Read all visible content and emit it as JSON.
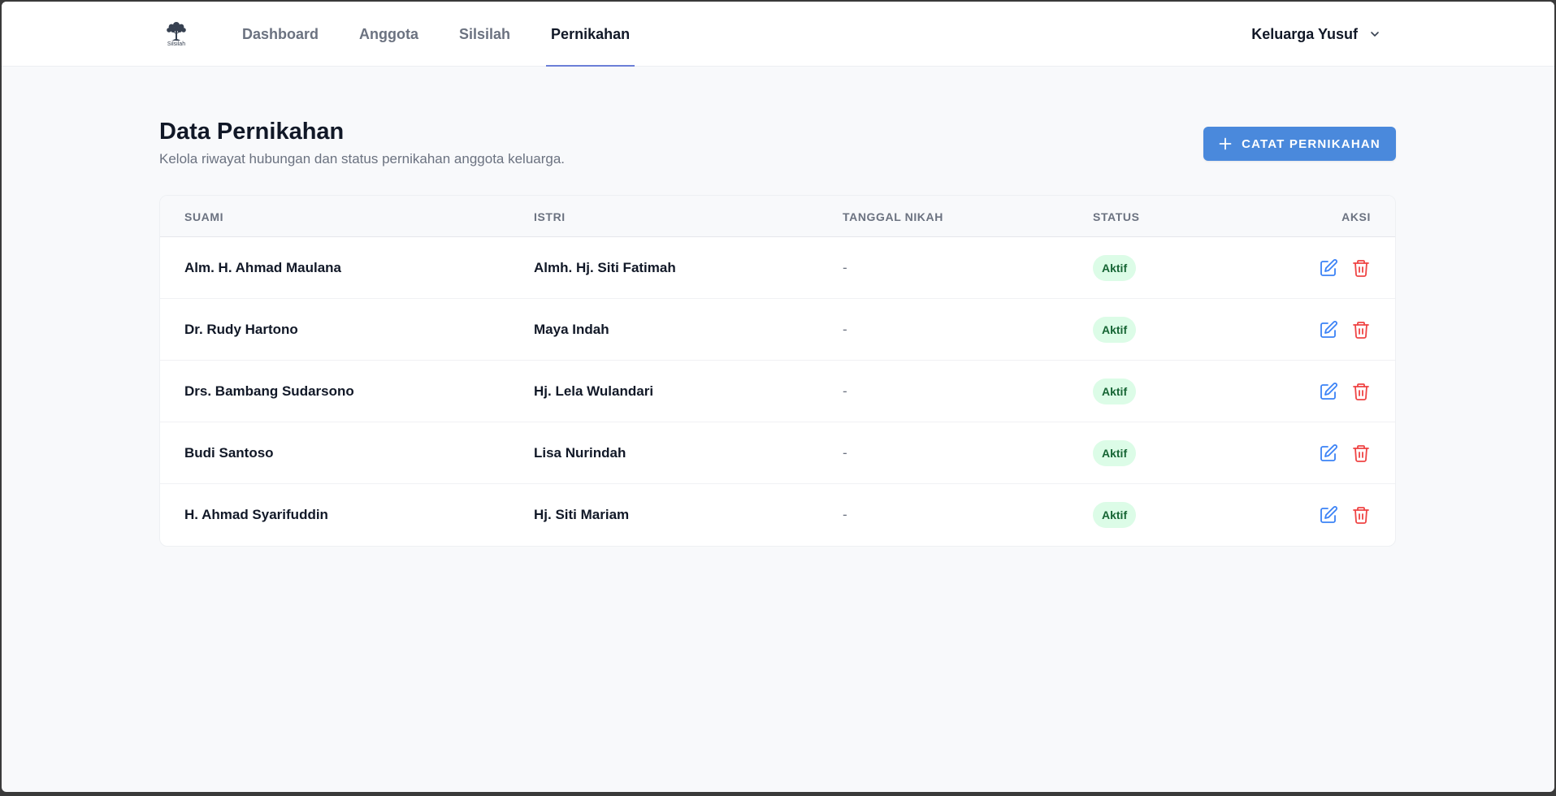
{
  "brand": {
    "logo_text": "Silsilah"
  },
  "nav": {
    "items": [
      {
        "label": "Dashboard"
      },
      {
        "label": "Anggota"
      },
      {
        "label": "Silsilah"
      },
      {
        "label": "Pernikahan"
      }
    ],
    "active": "Pernikahan"
  },
  "account": {
    "name": "Keluarga Yusuf",
    "icon": "chevron-down-icon"
  },
  "page": {
    "title": "Data Pernikahan",
    "subtitle": "Kelola riwayat hubungan dan status pernikahan anggota keluarga.",
    "add_button": "CATAT PERNIKAHAN"
  },
  "table": {
    "headers": {
      "suami": "SUAMI",
      "istri": "ISTRI",
      "tanggal": "TANGGAL NIKAH",
      "status": "STATUS",
      "aksi": "AKSI"
    },
    "rows": [
      {
        "suami": "Alm. H. Ahmad Maulana",
        "istri": "Almh. Hj. Siti Fatimah",
        "tanggal": "-",
        "status": "Aktif"
      },
      {
        "suami": "Dr. Rudy Hartono",
        "istri": "Maya Indah",
        "tanggal": "-",
        "status": "Aktif"
      },
      {
        "suami": "Drs. Bambang Sudarsono",
        "istri": "Hj. Lela Wulandari",
        "tanggal": "-",
        "status": "Aktif"
      },
      {
        "suami": "Budi Santoso",
        "istri": "Lisa Nurindah",
        "tanggal": "-",
        "status": "Aktif"
      },
      {
        "suami": "H. Ahmad Syarifuddin",
        "istri": "Hj. Siti Mariam",
        "tanggal": "-",
        "status": "Aktif"
      }
    ]
  },
  "colors": {
    "accent": "#4a89dc",
    "nav_underline": "#6b7fd7",
    "badge_bg": "#dcfce7",
    "badge_text": "#166534",
    "edit_icon": "#3b82f6",
    "delete_icon": "#ef4444"
  }
}
